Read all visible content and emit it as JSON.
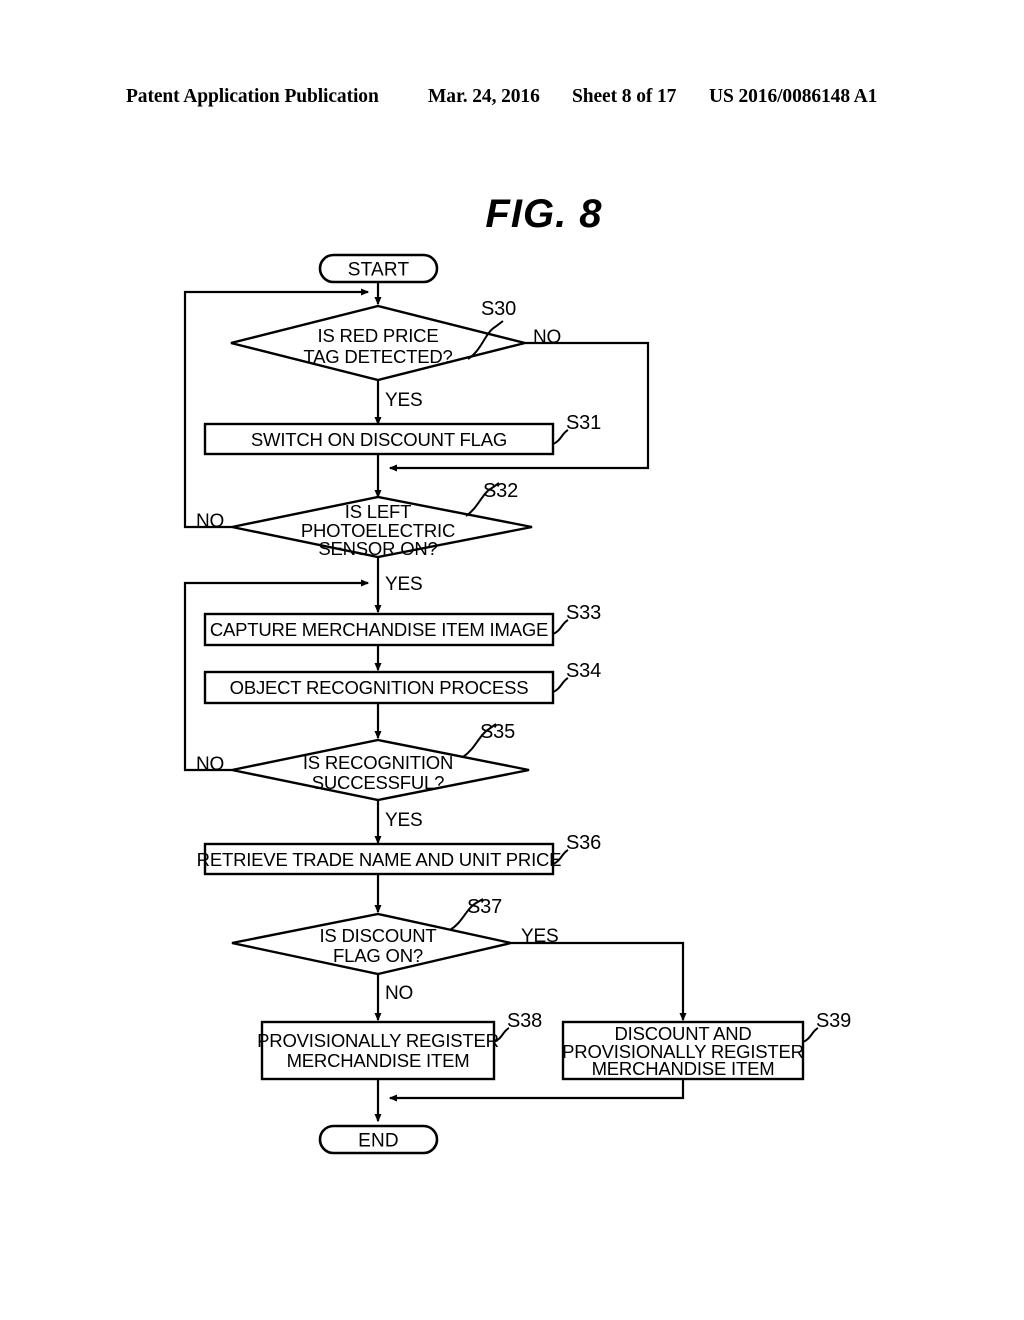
{
  "header": {
    "publication": "Patent Application Publication",
    "date": "Mar. 24, 2016",
    "sheet": "Sheet 8 of 17",
    "patent_number": "US 2016/0086148 A1"
  },
  "figure": {
    "title": "FIG. 8"
  },
  "flowchart": {
    "start_label": "START",
    "end_label": "END",
    "yes_label": "YES",
    "no_label": "NO",
    "nodes": [
      {
        "id": "S30",
        "type": "decision",
        "lines": [
          "IS RED PRICE",
          "TAG DETECTED?"
        ],
        "yes_branch": "YES",
        "no_branch": "NO"
      },
      {
        "id": "S31",
        "type": "process",
        "lines": [
          "SWITCH ON DISCOUNT FLAG"
        ]
      },
      {
        "id": "S32",
        "type": "decision",
        "lines": [
          "IS LEFT",
          "PHOTOELECTRIC",
          "SENSOR ON?"
        ],
        "yes_branch": "YES",
        "no_branch": "NO"
      },
      {
        "id": "S33",
        "type": "process",
        "lines": [
          "CAPTURE MERCHANDISE ITEM IMAGE"
        ]
      },
      {
        "id": "S34",
        "type": "process",
        "lines": [
          "OBJECT RECOGNITION PROCESS"
        ]
      },
      {
        "id": "S35",
        "type": "decision",
        "lines": [
          "IS RECOGNITION",
          "SUCCESSFUL?"
        ],
        "yes_branch": "YES",
        "no_branch": "NO"
      },
      {
        "id": "S36",
        "type": "process",
        "lines": [
          "RETRIEVE TRADE NAME AND UNIT PRICE"
        ]
      },
      {
        "id": "S37",
        "type": "decision",
        "lines": [
          "IS DISCOUNT",
          "FLAG ON?"
        ],
        "yes_branch": "YES",
        "no_branch": "NO"
      },
      {
        "id": "S38",
        "type": "process",
        "lines": [
          "PROVISIONALLY REGISTER",
          "MERCHANDISE ITEM"
        ]
      },
      {
        "id": "S39",
        "type": "process",
        "lines": [
          "DISCOUNT AND",
          "PROVISIONALLY REGISTER",
          "MERCHANDISE ITEM"
        ]
      }
    ]
  }
}
